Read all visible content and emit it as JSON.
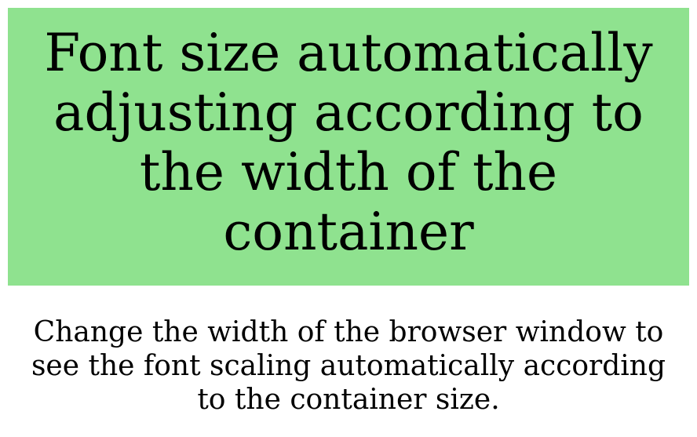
{
  "heading": {
    "text": "Font size automatically adjusting according to the width of the container",
    "bg_color": "#8fe28f"
  },
  "description": {
    "text": "Change the width of the browser window to see the font scaling automatically according to the container size."
  }
}
